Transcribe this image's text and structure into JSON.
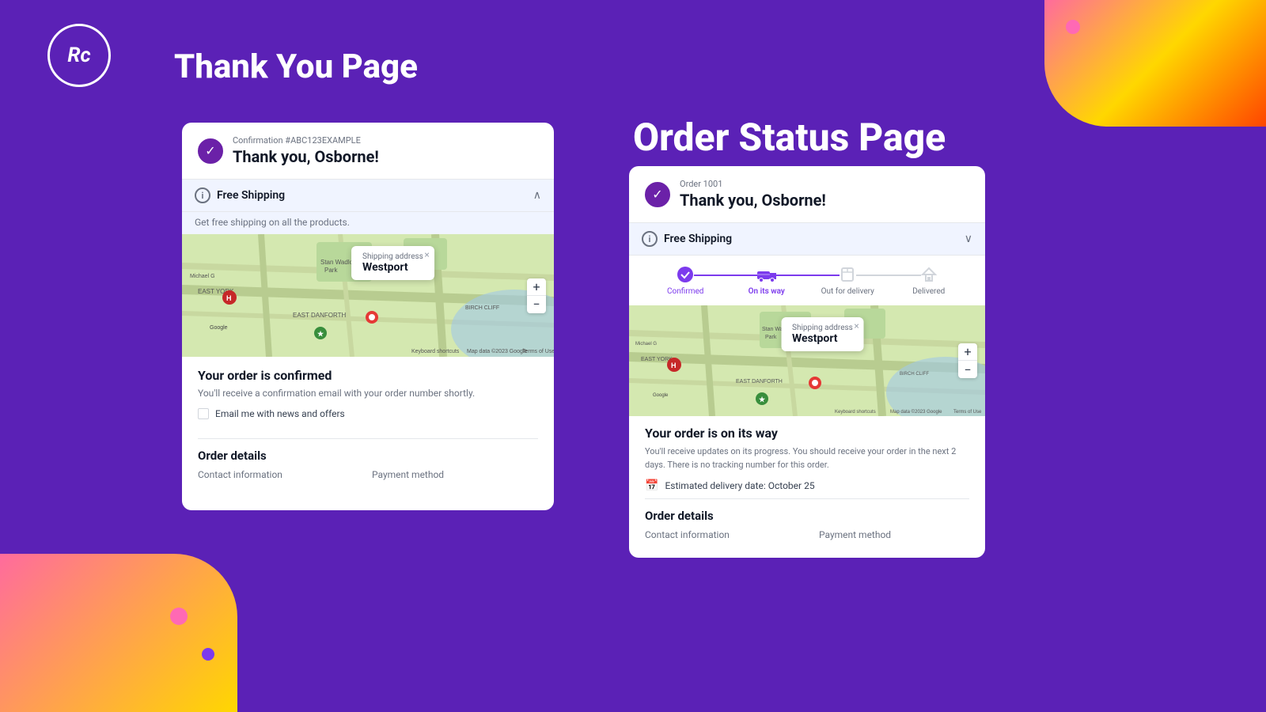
{
  "logo": {
    "text": "Rc"
  },
  "left_section": {
    "title": "Thank You Page",
    "card": {
      "confirmation_label": "Confirmation #ABC123EXAMPLE",
      "thank_you": "Thank you, Osborne!",
      "shipping": {
        "title": "Free Shipping",
        "subtitle": "Get free shipping on all the products.",
        "chevron": "∧"
      },
      "map": {
        "popup_label": "Shipping address",
        "popup_city": "Westport",
        "zoom_in": "+",
        "zoom_out": "−"
      },
      "order_confirmed": {
        "title": "Your order is confirmed",
        "description": "You'll receive a confirmation email with your order number shortly.",
        "checkbox_label": "Email me with news and offers"
      },
      "order_details": {
        "title": "Order details",
        "col1": "Contact information",
        "col2": "Payment method"
      }
    }
  },
  "right_section": {
    "title": "Order Status Page",
    "card": {
      "order_label": "Order 1001",
      "thank_you": "Thank you, Osborne!",
      "shipping": {
        "title": "Free Shipping",
        "chevron": "∨"
      },
      "progress": {
        "steps": [
          {
            "label": "Confirmed",
            "state": "done"
          },
          {
            "label": "On its way",
            "state": "active"
          },
          {
            "label": "Out for delivery",
            "state": "inactive"
          },
          {
            "label": "Delivered",
            "state": "inactive"
          }
        ]
      },
      "map": {
        "popup_label": "Shipping address",
        "popup_city": "Westport",
        "zoom_in": "+",
        "zoom_out": "−"
      },
      "on_its_way": {
        "title": "Your order is on its way",
        "description": "You'll receive updates on its progress. You should receive your order in the next 2 days. There is no tracking number for this order.",
        "delivery_date": "Estimated delivery date: October 25"
      },
      "order_details": {
        "title": "Order details",
        "col1": "Contact information",
        "col2": "Payment method"
      }
    }
  }
}
